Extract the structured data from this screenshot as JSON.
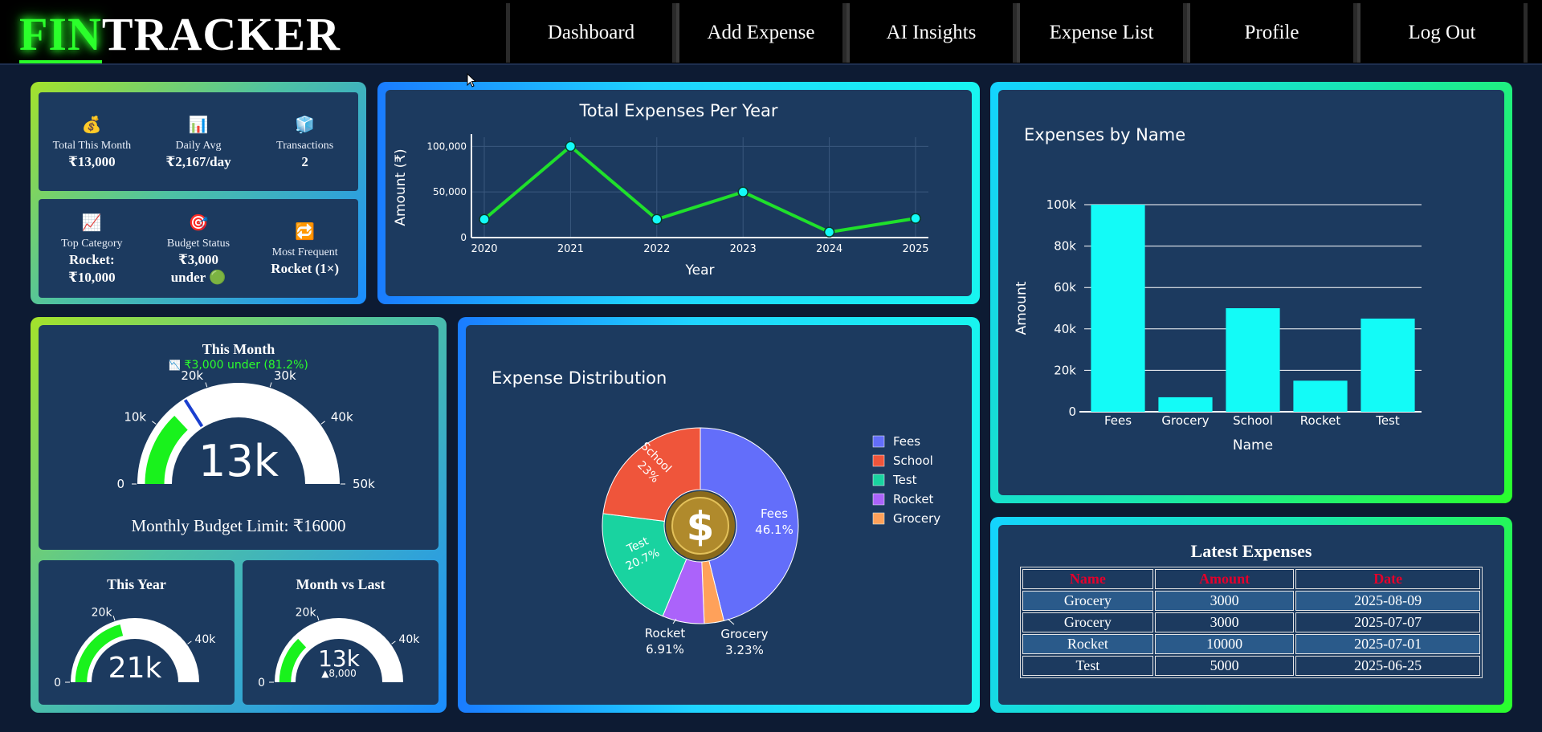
{
  "nav": {
    "logo_fin": "FIN",
    "logo_tracker": "TRACKER",
    "links": [
      "Dashboard",
      "Add Expense",
      "AI Insights",
      "Expense List",
      "Profile",
      "Log Out"
    ]
  },
  "stats": [
    {
      "icon": "money-bag-icon",
      "glyph": "💰",
      "label": "Total This Month",
      "value": "₹13,000"
    },
    {
      "icon": "bar-chart-icon",
      "glyph": "📊",
      "label": "Daily Avg",
      "value": "₹2,167/day"
    },
    {
      "icon": "cube-icon",
      "glyph": "🧊",
      "label": "Transactions",
      "value": "2"
    },
    {
      "icon": "trend-up-icon",
      "glyph": "📈",
      "label": "Top Category",
      "value": "Rocket:",
      "value2": "₹10,000"
    },
    {
      "icon": "target-icon",
      "glyph": "🎯",
      "label": "Budget Status",
      "value": "₹3,000",
      "value2": "under 🟢"
    },
    {
      "icon": "repeat-icon",
      "glyph": "🔁",
      "label": "Most Frequent",
      "value": "Rocket (1×)"
    }
  ],
  "line_chart": {
    "title": "Total Expenses Per Year",
    "xlabel": "Year",
    "ylabel": "Amount (₹)",
    "y_ticks": [
      "0",
      "50,000",
      "100,000"
    ],
    "color": "#1fe02b"
  },
  "bar_chart": {
    "title": "Expenses by Name",
    "xlabel": "Name",
    "ylabel": "Amount",
    "y_ticks": [
      "0",
      "20k",
      "40k",
      "60k",
      "80k",
      "100k"
    ],
    "color": "#13fbf7"
  },
  "pie_chart": {
    "title": "Expense Distribution",
    "legend": [
      "Fees",
      "School",
      "Test",
      "Rocket",
      "Grocery"
    ]
  },
  "gauges": {
    "month": {
      "title": "This Month",
      "subtitle": "₹3,000 under (81.2%)",
      "value_text": "13k",
      "ticks": [
        "0",
        "10k",
        "20k",
        "30k",
        "40k",
        "50k"
      ],
      "footer": "Monthly Budget Limit: ₹16000",
      "value": 13000,
      "max": 50000,
      "threshold": 16000
    },
    "year": {
      "title": "This Year",
      "value_text": "21k",
      "ticks": [
        "0",
        "20k",
        "40k"
      ],
      "value": 21000,
      "max": 50000
    },
    "mvl": {
      "title": "Month vs Last",
      "value_text": "13k",
      "delta": "▲8,000",
      "ticks": [
        "0",
        "20k",
        "40k"
      ],
      "value": 13000,
      "max": 50000
    }
  },
  "latest": {
    "title": "Latest Expenses",
    "headers": [
      "Name",
      "Amount",
      "Date"
    ],
    "rows": [
      [
        "Grocery",
        "3000",
        "2025-08-09"
      ],
      [
        "Grocery",
        "3000",
        "2025-07-07"
      ],
      [
        "Rocket",
        "10000",
        "2025-07-01"
      ],
      [
        "Test",
        "5000",
        "2025-06-25"
      ]
    ]
  },
  "chart_data": [
    {
      "type": "line",
      "title": "Total Expenses Per Year",
      "xlabel": "Year",
      "ylabel": "Amount (₹)",
      "x": [
        "2020",
        "2021",
        "2022",
        "2023",
        "2024",
        "2025"
      ],
      "values": [
        20000,
        100000,
        20000,
        50000,
        6000,
        21000
      ],
      "ylim": [
        0,
        110000
      ],
      "grid": true
    },
    {
      "type": "bar",
      "title": "Expenses by Name",
      "xlabel": "Name",
      "ylabel": "Amount",
      "categories": [
        "Fees",
        "Grocery",
        "School",
        "Rocket",
        "Test"
      ],
      "values": [
        100000,
        7000,
        50000,
        15000,
        45000
      ],
      "ylim": [
        0,
        100000
      ],
      "grid": true
    },
    {
      "type": "pie",
      "title": "Expense Distribution",
      "categories": [
        "Fees",
        "School",
        "Test",
        "Rocket",
        "Grocery"
      ],
      "values": [
        46.1,
        23,
        20.7,
        6.91,
        3.23
      ],
      "labels": [
        "46.1%",
        "23%",
        "20.7%",
        "6.91%",
        "3.23%"
      ],
      "colors": [
        "#636efa",
        "#ef553b",
        "#19d3a0",
        "#ab63fa",
        "#ffa15a"
      ],
      "legend": "right"
    }
  ]
}
